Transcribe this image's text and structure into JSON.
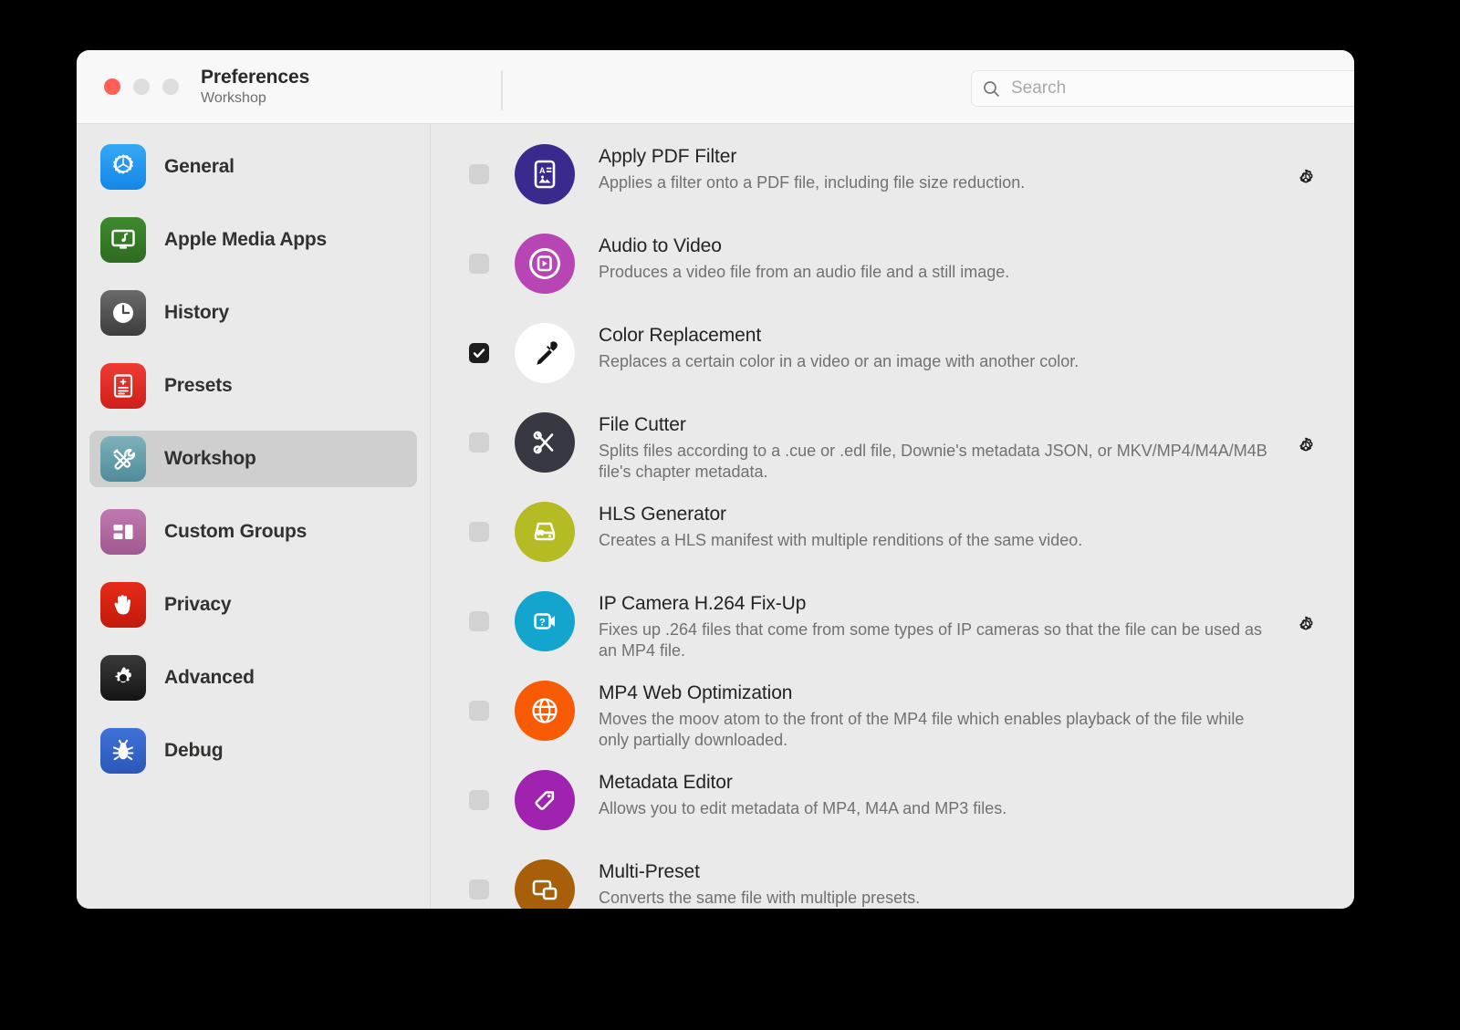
{
  "window": {
    "title": "Preferences",
    "subtitle": "Workshop",
    "traffic_lights": [
      "close",
      "minimize",
      "zoom"
    ]
  },
  "search": {
    "placeholder": "Search",
    "value": "",
    "icon": "search-icon"
  },
  "sidebar": {
    "items": [
      {
        "label": "General",
        "icon": "gear-icon",
        "selected": false
      },
      {
        "label": "Apple Media Apps",
        "icon": "monitor-music-icon",
        "selected": false
      },
      {
        "label": "History",
        "icon": "clock-icon",
        "selected": false
      },
      {
        "label": "Presets",
        "icon": "document-icon",
        "selected": false
      },
      {
        "label": "Workshop",
        "icon": "tools-icon",
        "selected": true
      },
      {
        "label": "Custom Groups",
        "icon": "grid-panels-icon",
        "selected": false
      },
      {
        "label": "Privacy",
        "icon": "hand-icon",
        "selected": false
      },
      {
        "label": "Advanced",
        "icon": "cog-icon",
        "selected": false
      },
      {
        "label": "Debug",
        "icon": "bug-icon",
        "selected": false
      }
    ]
  },
  "main": {
    "rows": [
      {
        "title": "Apply PDF Filter",
        "description": "Applies a filter onto a PDF file, including file size reduction.",
        "checked": false,
        "icon": "pdf-document-icon",
        "has_settings": true
      },
      {
        "title": "Audio to Video",
        "description": "Produces a video file from an audio file and a still image.",
        "checked": false,
        "icon": "video-play-icon",
        "has_settings": false
      },
      {
        "title": "Color Replacement",
        "description": "Replaces a certain color in a video or an image with another color.",
        "checked": true,
        "icon": "eyedropper-icon",
        "has_settings": false
      },
      {
        "title": "File Cutter",
        "description": "Splits files according to a .cue or .edl file, Downie's metadata JSON, or MKV/MP4/M4A/M4B file's chapter metadata.",
        "checked": false,
        "icon": "scissors-icon",
        "has_settings": true
      },
      {
        "title": "HLS Generator",
        "description": "Creates a HLS manifest with multiple renditions of the same video.",
        "checked": false,
        "icon": "streaming-icon",
        "has_settings": false
      },
      {
        "title": "IP Camera H.264 Fix-Up",
        "description": "Fixes up .264 files that come from some types of IP cameras so that the file can be used as an MP4 file.",
        "checked": false,
        "icon": "video-camera-question-icon",
        "has_settings": true
      },
      {
        "title": "MP4 Web Optimization",
        "description": "Moves the moov atom to the front of the MP4 file which enables playback of the file while only partially downloaded.",
        "checked": false,
        "icon": "globe-icon",
        "has_settings": false
      },
      {
        "title": "Metadata Editor",
        "description": "Allows you to edit metadata of MP4, M4A and MP3 files.",
        "checked": false,
        "icon": "tag-icon",
        "has_settings": false
      },
      {
        "title": "Multi-Preset",
        "description": "Converts the same file with multiple presets.",
        "checked": false,
        "icon": "multi-window-icon",
        "has_settings": false
      }
    ],
    "settings_icon": "gear-icon"
  },
  "colors": {
    "window_background": "#eaeaea",
    "toolbar_background": "#f8f8f8",
    "selection": "#cfcfcf",
    "close_button": "#ff5f57",
    "checkbox_checked": "#1d1d1d",
    "checkbox_unchecked": "#d2d2d2",
    "title_text": "#232323",
    "description_text": "#717171"
  }
}
